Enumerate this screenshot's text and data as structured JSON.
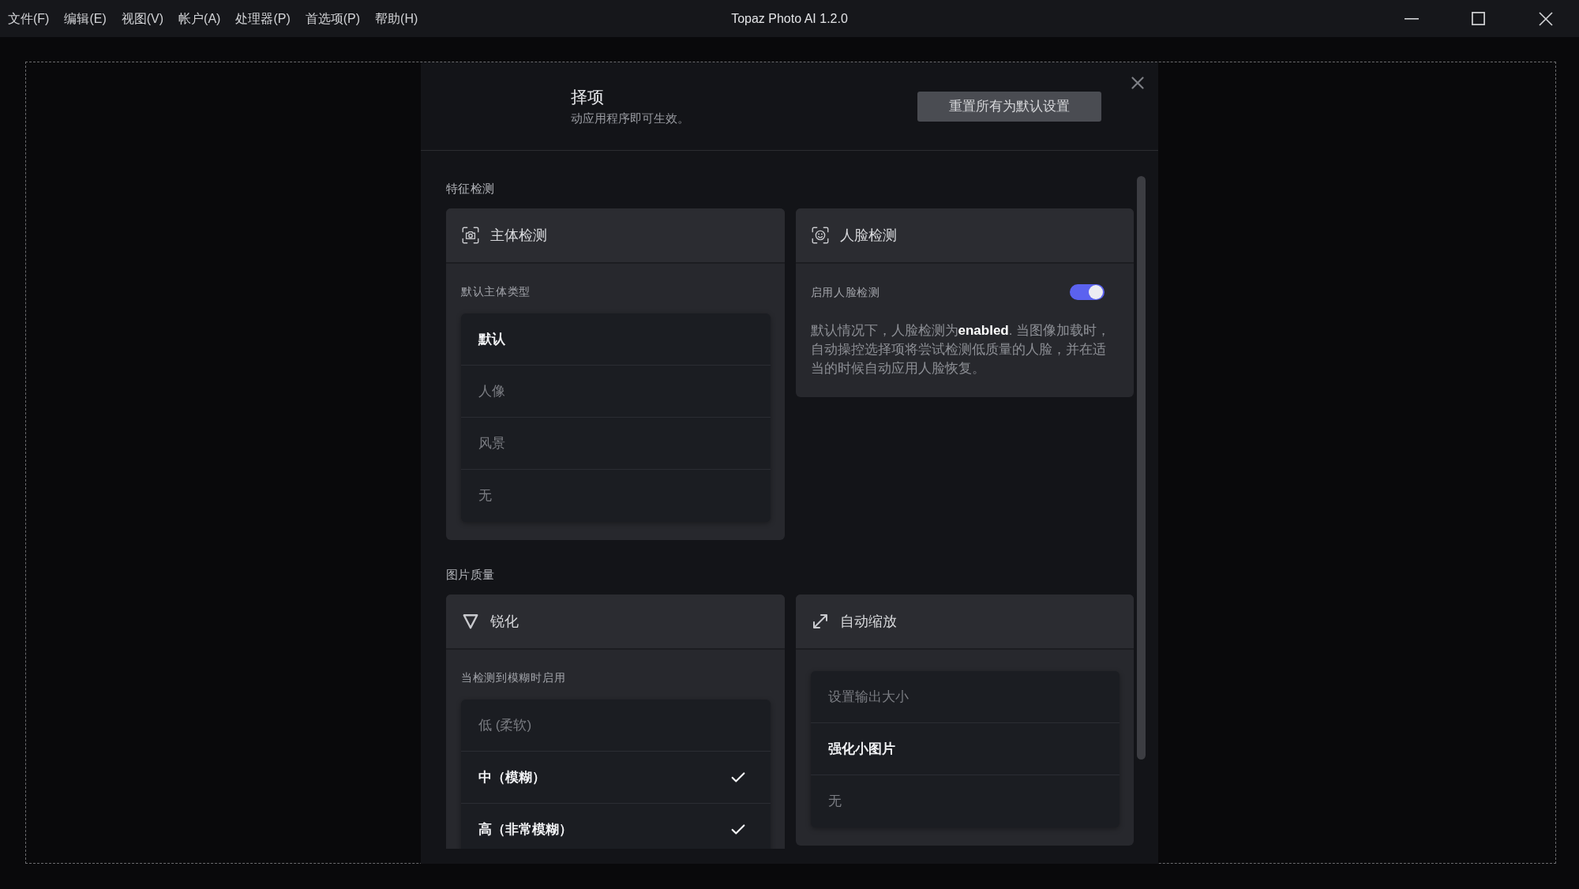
{
  "window": {
    "menu": [
      "文件(F)",
      "编辑(E)",
      "视图(V)",
      "帐户(A)",
      "处理器(P)",
      "首选项(P)",
      "帮助(H)"
    ],
    "title": "Topaz Photo AI 1.2.0"
  },
  "dialog": {
    "title": "择项",
    "subtitle": "动应用程序即可生效。",
    "reset_button": "重置所有为默认设置",
    "sections": [
      {
        "label": "特征检测",
        "cards": [
          {
            "kind": "list",
            "title": "主体检测",
            "label": "默认主体类型",
            "options": [
              {
                "text": "默认",
                "selected": true
              },
              {
                "text": "人像",
                "selected": false
              },
              {
                "text": "风景",
                "selected": false
              },
              {
                "text": "无",
                "selected": false
              }
            ]
          },
          {
            "kind": "toggle",
            "title": "人脸检测",
            "toggle": {
              "label": "启用人脸检测",
              "on": true
            },
            "description": "默认情况下，人脸检测为**enabled**. 当图像加载时，自动操控选择项将尝试检测低质量的人脸，并在适当的时候自动应用人脸恢复。"
          }
        ]
      },
      {
        "label": "图片质量",
        "cards": [
          {
            "kind": "checklist",
            "title": "锐化",
            "label": "当检测到模糊时启用",
            "options": [
              {
                "text": "低 (柔软)",
                "checked": false
              },
              {
                "text": "中（模糊）",
                "checked": true
              },
              {
                "text": "高（非常模糊）",
                "checked": true
              }
            ]
          },
          {
            "kind": "list",
            "title": "自动缩放",
            "options": [
              {
                "text": "设置输出大小",
                "selected": false
              },
              {
                "text": "强化小图片",
                "selected": true
              },
              {
                "text": "无",
                "selected": false
              }
            ]
          }
        ]
      }
    ]
  }
}
